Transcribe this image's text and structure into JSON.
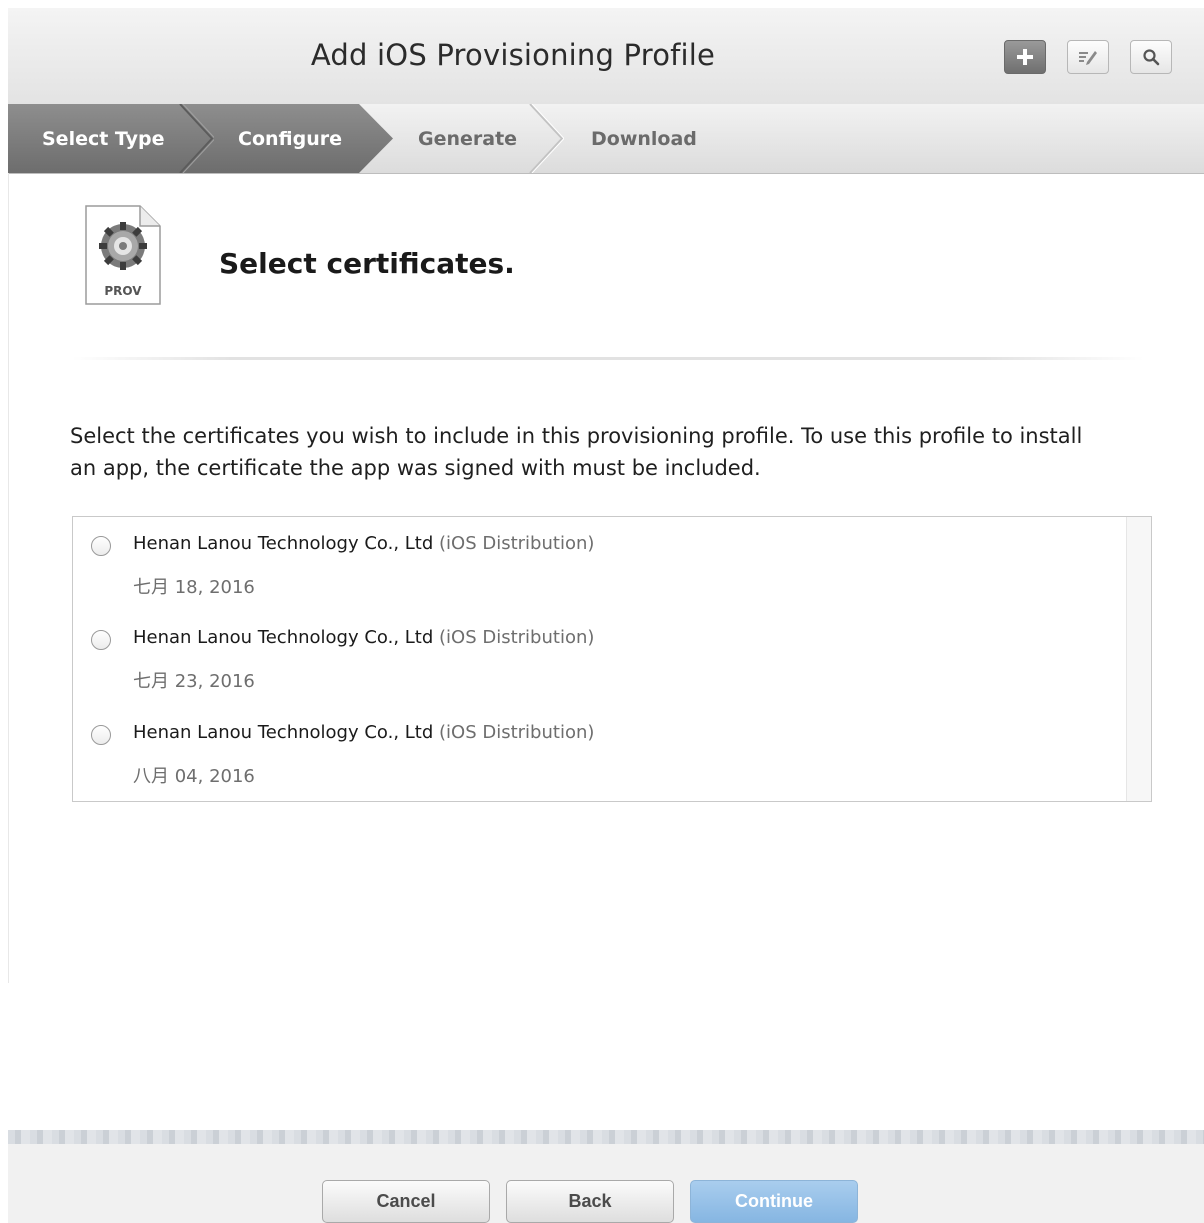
{
  "header": {
    "title": "Add iOS Provisioning Profile",
    "tools": [
      {
        "name": "add",
        "icon": "plus-icon"
      },
      {
        "name": "edit",
        "icon": "edit-icon"
      },
      {
        "name": "search",
        "icon": "search-icon"
      }
    ]
  },
  "steps": [
    {
      "label": "Select Type",
      "state": "done"
    },
    {
      "label": "Configure",
      "state": "current"
    },
    {
      "label": "Generate",
      "state": "upcoming"
    },
    {
      "label": "Download",
      "state": "upcoming"
    }
  ],
  "content": {
    "icon_label": "PROV",
    "heading": "Select certificates.",
    "instructions": "Select the certificates you wish to include in this provisioning profile. To use this profile to install an app, the certificate the app was signed with must be included."
  },
  "certificates": [
    {
      "name": "Henan Lanou Technology Co., Ltd",
      "type": "(iOS Distribution)",
      "date": "七月 18, 2016",
      "selected": false
    },
    {
      "name": "Henan Lanou Technology Co., Ltd",
      "type": "(iOS Distribution)",
      "date": "七月 23, 2016",
      "selected": false
    },
    {
      "name": "Henan Lanou Technology Co., Ltd",
      "type": "(iOS Distribution)",
      "date": "八月 04, 2016",
      "selected": false
    }
  ],
  "footer": {
    "cancel_label": "Cancel",
    "back_label": "Back",
    "continue_label": "Continue"
  },
  "colors": {
    "continue_button": "#95c1e8",
    "step_active": "#7a7a7a"
  }
}
